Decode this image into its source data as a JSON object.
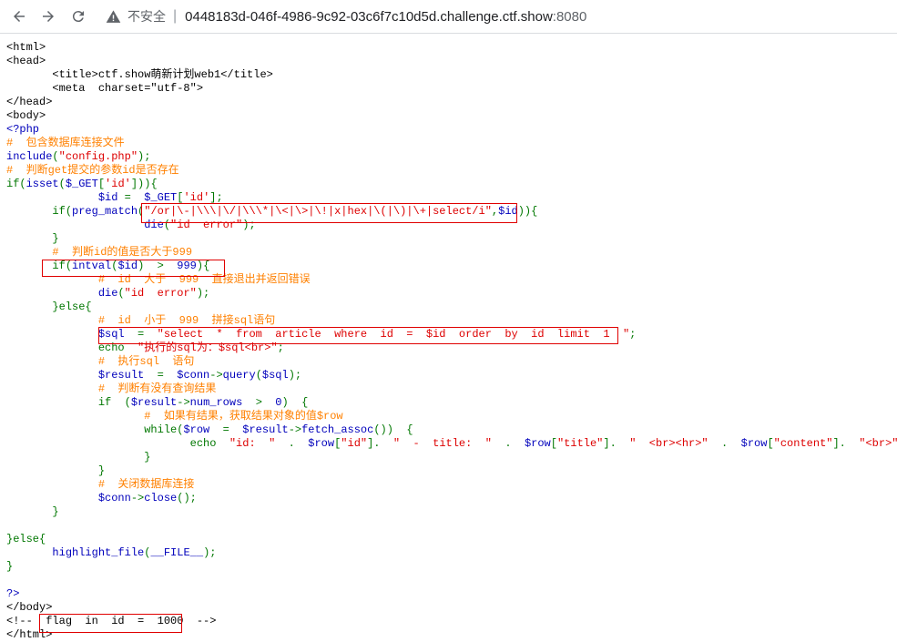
{
  "browser": {
    "security_label": "不安全",
    "separator": "|",
    "host": "0448183d-046f-4986-9c92-03c6f7c10d5d.challenge.ctf.show",
    "port": ":8080"
  },
  "source_lines": [
    [
      {
        "t": "<html>",
        "c": "x"
      }
    ],
    [
      {
        "t": "<head>",
        "c": "x"
      }
    ],
    [
      {
        "t": "       <title>ctf.show萌新计划web1</title>",
        "c": "x"
      }
    ],
    [
      {
        "t": "       <meta  charset=\"utf-8\">",
        "c": "x"
      }
    ],
    [
      {
        "t": "</head>",
        "c": "x"
      }
    ],
    [
      {
        "t": "<body>",
        "c": "x"
      }
    ],
    [
      {
        "t": "<?php",
        "c": "k"
      }
    ],
    [
      {
        "t": "#  包含数据库连接文件",
        "c": "c"
      }
    ],
    [
      {
        "t": "include",
        "c": "k"
      },
      {
        "t": "(",
        "c": "g"
      },
      {
        "t": "\"config.php\"",
        "c": "s"
      },
      {
        "t": ");",
        "c": "g"
      }
    ],
    [
      {
        "t": "#  判断get提交的参数id是否存在",
        "c": "c"
      }
    ],
    [
      {
        "t": "if",
        "c": "g"
      },
      {
        "t": "(",
        "c": "g"
      },
      {
        "t": "isset",
        "c": "k"
      },
      {
        "t": "(",
        "c": "g"
      },
      {
        "t": "$_GET",
        "c": "k"
      },
      {
        "t": "[",
        "c": "g"
      },
      {
        "t": "'id'",
        "c": "s"
      },
      {
        "t": "])){",
        "c": "g"
      }
    ],
    [
      {
        "t": "              ",
        "c": "x"
      },
      {
        "t": "$id ",
        "c": "k"
      },
      {
        "t": "= ",
        "c": "g"
      },
      {
        "t": " $_GET",
        "c": "k"
      },
      {
        "t": "[",
        "c": "g"
      },
      {
        "t": "'id'",
        "c": "s"
      },
      {
        "t": "];",
        "c": "g"
      }
    ],
    [
      {
        "t": "       ",
        "c": "x"
      },
      {
        "t": "if",
        "c": "g"
      },
      {
        "t": "(",
        "c": "g"
      },
      {
        "t": "preg_match",
        "c": "k"
      },
      {
        "t": "(",
        "c": "g"
      },
      {
        "t": "\"/or|\\-|\\\\\\|\\/|\\\\\\*|\\<|\\>|\\!|x|hex|\\(|\\)|\\+|select/i\"",
        "c": "s"
      },
      {
        "t": ",",
        "c": "g"
      },
      {
        "t": "$id",
        "c": "k"
      },
      {
        "t": ")){",
        "c": "g"
      }
    ],
    [
      {
        "t": "                     ",
        "c": "x"
      },
      {
        "t": "die",
        "c": "k"
      },
      {
        "t": "(",
        "c": "g"
      },
      {
        "t": "\"id  error\"",
        "c": "s"
      },
      {
        "t": ");",
        "c": "g"
      }
    ],
    [
      {
        "t": "       }",
        "c": "g"
      }
    ],
    [
      {
        "t": "       #  判断id的值是否大于999",
        "c": "c"
      }
    ],
    [
      {
        "t": "       ",
        "c": "x"
      },
      {
        "t": "if",
        "c": "g"
      },
      {
        "t": "(",
        "c": "g"
      },
      {
        "t": "intval",
        "c": "k"
      },
      {
        "t": "(",
        "c": "g"
      },
      {
        "t": "$id",
        "c": "k"
      },
      {
        "t": ")  ",
        "c": "g"
      },
      {
        "t": ">  ",
        "c": "g"
      },
      {
        "t": "999",
        "c": "k"
      },
      {
        "t": "){",
        "c": "g"
      }
    ],
    [
      {
        "t": "              #  id  大于  999  直接退出并返回错误",
        "c": "c"
      }
    ],
    [
      {
        "t": "              ",
        "c": "x"
      },
      {
        "t": "die",
        "c": "k"
      },
      {
        "t": "(",
        "c": "g"
      },
      {
        "t": "\"id  error\"",
        "c": "s"
      },
      {
        "t": ");",
        "c": "g"
      }
    ],
    [
      {
        "t": "       }else{",
        "c": "g"
      }
    ],
    [
      {
        "t": "              #  id  小于  999  拼接sql语句",
        "c": "c"
      }
    ],
    [
      {
        "t": "              ",
        "c": "x"
      },
      {
        "t": "$sql  ",
        "c": "k"
      },
      {
        "t": "=  ",
        "c": "g"
      },
      {
        "t": "\"select  *  from  article  where  id  =  $id  order  by  id  limit  1  \"",
        "c": "s"
      },
      {
        "t": ";",
        "c": "g"
      }
    ],
    [
      {
        "t": "              ",
        "c": "x"
      },
      {
        "t": "echo  ",
        "c": "g"
      },
      {
        "t": "\"执行的sql为：$sql<br>\"",
        "c": "s"
      },
      {
        "t": ";",
        "c": "g"
      }
    ],
    [
      {
        "t": "              #  执行sql  语句",
        "c": "c"
      }
    ],
    [
      {
        "t": "              ",
        "c": "x"
      },
      {
        "t": "$result  ",
        "c": "k"
      },
      {
        "t": "=  ",
        "c": "g"
      },
      {
        "t": "$conn",
        "c": "k"
      },
      {
        "t": "->",
        "c": "g"
      },
      {
        "t": "query",
        "c": "k"
      },
      {
        "t": "(",
        "c": "g"
      },
      {
        "t": "$sql",
        "c": "k"
      },
      {
        "t": ");",
        "c": "g"
      }
    ],
    [
      {
        "t": "              #  判断有没有查询结果",
        "c": "c"
      }
    ],
    [
      {
        "t": "              ",
        "c": "x"
      },
      {
        "t": "if  ",
        "c": "g"
      },
      {
        "t": "(",
        "c": "g"
      },
      {
        "t": "$result",
        "c": "k"
      },
      {
        "t": "->",
        "c": "g"
      },
      {
        "t": "num_rows  ",
        "c": "k"
      },
      {
        "t": ">  ",
        "c": "g"
      },
      {
        "t": "0",
        "c": "k"
      },
      {
        "t": ")  {",
        "c": "g"
      }
    ],
    [
      {
        "t": "                     #  如果有结果，获取结果对象的值$row",
        "c": "c"
      }
    ],
    [
      {
        "t": "                     ",
        "c": "x"
      },
      {
        "t": "while",
        "c": "g"
      },
      {
        "t": "(",
        "c": "g"
      },
      {
        "t": "$row  ",
        "c": "k"
      },
      {
        "t": "=  ",
        "c": "g"
      },
      {
        "t": "$result",
        "c": "k"
      },
      {
        "t": "->",
        "c": "g"
      },
      {
        "t": "fetch_assoc",
        "c": "k"
      },
      {
        "t": "())  {",
        "c": "g"
      }
    ],
    [
      {
        "t": "                            ",
        "c": "x"
      },
      {
        "t": "echo  ",
        "c": "g"
      },
      {
        "t": "\"id:  \"  ",
        "c": "s"
      },
      {
        "t": ".  ",
        "c": "g"
      },
      {
        "t": "$row",
        "c": "k"
      },
      {
        "t": "[",
        "c": "g"
      },
      {
        "t": "\"id\"",
        "c": "s"
      },
      {
        "t": "].  ",
        "c": "g"
      },
      {
        "t": "\"  -  title:  \"  ",
        "c": "s"
      },
      {
        "t": ".  ",
        "c": "g"
      },
      {
        "t": "$row",
        "c": "k"
      },
      {
        "t": "[",
        "c": "g"
      },
      {
        "t": "\"title\"",
        "c": "s"
      },
      {
        "t": "].  ",
        "c": "g"
      },
      {
        "t": "\"  <br><hr>\"  ",
        "c": "s"
      },
      {
        "t": ".  ",
        "c": "g"
      },
      {
        "t": "$row",
        "c": "k"
      },
      {
        "t": "[",
        "c": "g"
      },
      {
        "t": "\"content\"",
        "c": "s"
      },
      {
        "t": "].  ",
        "c": "g"
      },
      {
        "t": "\"<br>\"",
        "c": "s"
      },
      {
        "t": ";",
        "c": "g"
      }
    ],
    [
      {
        "t": "                     }",
        "c": "g"
      }
    ],
    [
      {
        "t": "              }",
        "c": "g"
      }
    ],
    [
      {
        "t": "              #  关闭数据库连接",
        "c": "c"
      }
    ],
    [
      {
        "t": "              ",
        "c": "x"
      },
      {
        "t": "$conn",
        "c": "k"
      },
      {
        "t": "->",
        "c": "g"
      },
      {
        "t": "close",
        "c": "k"
      },
      {
        "t": "();",
        "c": "g"
      }
    ],
    [
      {
        "t": "       }",
        "c": "g"
      }
    ],
    [
      {
        "t": "",
        "c": "x"
      }
    ],
    [
      {
        "t": "}else{",
        "c": "g"
      }
    ],
    [
      {
        "t": "       ",
        "c": "x"
      },
      {
        "t": "highlight_file",
        "c": "k"
      },
      {
        "t": "(",
        "c": "g"
      },
      {
        "t": "__FILE__",
        "c": "k"
      },
      {
        "t": ");",
        "c": "g"
      }
    ],
    [
      {
        "t": "}",
        "c": "g"
      }
    ],
    [
      {
        "t": "",
        "c": "x"
      }
    ],
    [
      {
        "t": "?>",
        "c": "k"
      }
    ],
    [
      {
        "t": "</body>",
        "c": "x"
      }
    ],
    [
      {
        "t": "<!--  ",
        "c": "x"
      },
      {
        "t": "flag  in  id  =  1000",
        "c": "x"
      },
      {
        "t": "  -->",
        "c": "x"
      }
    ],
    [
      {
        "t": "</html>",
        "c": "x"
      }
    ]
  ]
}
